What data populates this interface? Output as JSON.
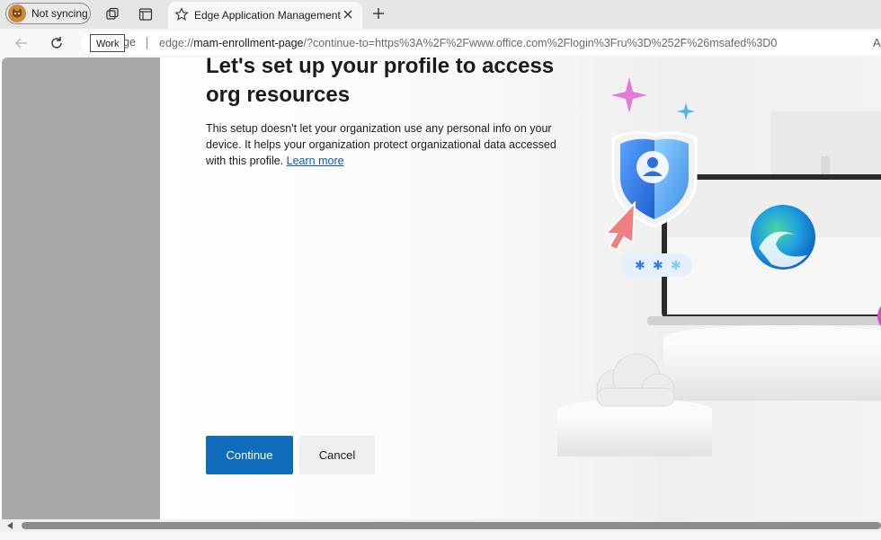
{
  "tabstrip": {
    "profile_label": "Not syncing",
    "tab_title": "Edge Application Management"
  },
  "toolbar": {
    "tooltip": "Work",
    "site_label_fragment": "ge",
    "url_host": "mam-enrollment-page",
    "url_scheme": "edge://",
    "url_rest": "/?continue-to=https%3A%2F%2Fwww.office.com%2Flogin%3Fru%3D%252F%26msafed%3D0",
    "right_glyph": "A"
  },
  "dialog": {
    "title": "Let's set up your profile to access org resources",
    "description": "This setup doesn't let your organization use any personal info on your device. It helps your organization protect organizational data accessed with this profile.",
    "learn_more": "Learn more",
    "continue_label": "Continue",
    "cancel_label": "Cancel"
  },
  "colors": {
    "accent": "#0f6cbd",
    "link": "#0f5bb5",
    "side_panel": "#a9a9a9"
  },
  "icons": [
    "profile-avatar-icon",
    "workspaces-icon",
    "vertical-tabs-icon",
    "favorite-star-icon",
    "close-icon",
    "plus-icon",
    "back-arrow-icon",
    "refresh-icon",
    "shield-icon",
    "edge-logo-icon"
  ]
}
